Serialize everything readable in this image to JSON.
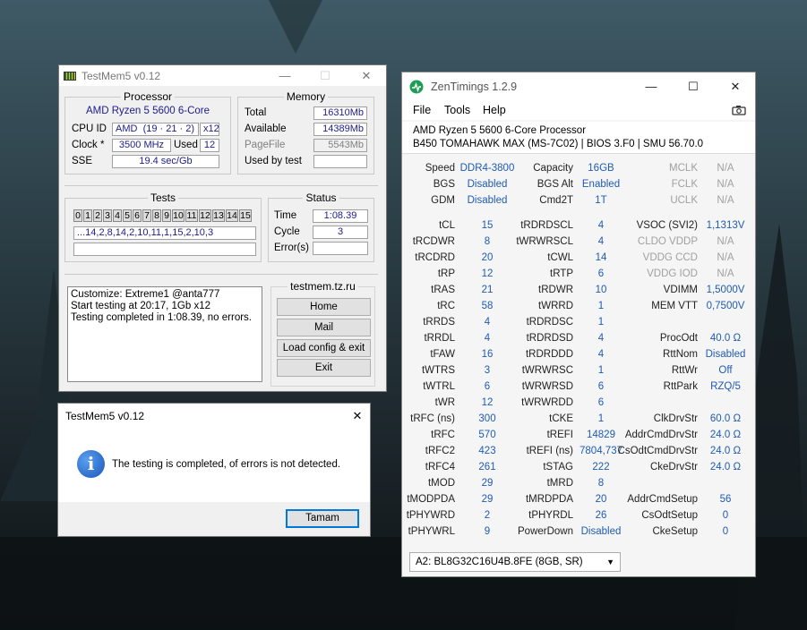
{
  "testmem": {
    "title": "TestMem5 v0.12",
    "controls": {
      "minimize": "—",
      "maximize": "☐",
      "close": "✕"
    },
    "processor": {
      "group_title": "Processor",
      "name": "AMD Ryzen 5 5600 6-Core",
      "cpu_id_label": "CPU ID",
      "cpu_id_vendor": "AMD",
      "cpu_id_value": "(19 · 21 · 2)",
      "cpu_id_threads": "x12",
      "clock_label": "Clock *",
      "clock_value": "3500 MHz",
      "used_label": "Used",
      "used_value": "12",
      "sse_label": "SSE",
      "sse_value": "19.4 sec/Gb"
    },
    "memory": {
      "group_title": "Memory",
      "total_label": "Total",
      "total_value": "16310Mb",
      "available_label": "Available",
      "available_value": "14389Mb",
      "pagefile_label": "PageFile",
      "pagefile_value": "5543Mb",
      "usedbytest_label": "Used by test",
      "usedbytest_value": ""
    },
    "tests": {
      "group_title": "Tests",
      "cells": [
        "0",
        "1",
        "2",
        "3",
        "4",
        "5",
        "6",
        "7",
        "8",
        "9",
        "10",
        "11",
        "12",
        "13",
        "14",
        "15"
      ],
      "sequence": "...14,2,8,14,2,10,11,1,15,2,10,3"
    },
    "status": {
      "group_title": "Status",
      "time_label": "Time",
      "time_value": "1:08.39",
      "cycle_label": "Cycle",
      "cycle_value": "3",
      "errors_label": "Error(s)",
      "errors_value": ""
    },
    "log": {
      "line1": "Customize: Extreme1 @anta777",
      "line2": "Start testing at 20:17, 1Gb x12",
      "line3": "Testing completed in 1:08.39, no errors."
    },
    "site": "testmem.tz.ru",
    "buttons": {
      "home": "Home",
      "mail": "Mail",
      "load": "Load config & exit",
      "exit": "Exit"
    }
  },
  "dialog": {
    "title": "TestMem5 v0.12",
    "close": "✕",
    "icon": "i",
    "message": "The testing is completed, of errors is not detected.",
    "ok": "Tamam"
  },
  "zen": {
    "title": "ZenTimings 1.2.9",
    "controls": {
      "minimize": "—",
      "maximize": "☐",
      "close": "✕"
    },
    "menu": {
      "file": "File",
      "tools": "Tools",
      "help": "Help"
    },
    "cpu": "AMD Ryzen 5 5600 6-Core Processor",
    "board": "B450 TOMAHAWK MAX (MS-7C02) | BIOS 3.F0 | SMU 56.70.0",
    "top": [
      [
        "Speed",
        "DDR4-3800",
        "Capacity",
        "16GB",
        "MCLK",
        "N/A"
      ],
      [
        "BGS",
        "Disabled",
        "BGS Alt",
        "Enabled",
        "FCLK",
        "N/A"
      ],
      [
        "GDM",
        "Disabled",
        "Cmd2T",
        "1T",
        "UCLK",
        "N/A"
      ]
    ],
    "timings": [
      [
        "tCL",
        "15",
        "tRDRDSCL",
        "4",
        "VSOC (SVI2)",
        "1,1313V"
      ],
      [
        "tRCDWR",
        "8",
        "tWRWRSCL",
        "4",
        "CLDO VDDP",
        "N/A"
      ],
      [
        "tRCDRD",
        "20",
        "tCWL",
        "14",
        "VDDG CCD",
        "N/A"
      ],
      [
        "tRP",
        "12",
        "tRTP",
        "6",
        "VDDG IOD",
        "N/A"
      ],
      [
        "tRAS",
        "21",
        "tRDWR",
        "10",
        "VDIMM",
        "1,5000V"
      ],
      [
        "tRC",
        "58",
        "tWRRD",
        "1",
        "MEM VTT",
        "0,7500V"
      ],
      [
        "tRRDS",
        "4",
        "tRDRDSC",
        "1",
        "",
        ""
      ],
      [
        "tRRDL",
        "4",
        "tRDRDSD",
        "4",
        "ProcOdt",
        "40.0 Ω"
      ],
      [
        "tFAW",
        "16",
        "tRDRDDD",
        "4",
        "RttNom",
        "Disabled"
      ],
      [
        "tWTRS",
        "3",
        "tWRWRSC",
        "1",
        "RttWr",
        "Off"
      ],
      [
        "tWTRL",
        "6",
        "tWRWRSD",
        "6",
        "RttPark",
        "RZQ/5"
      ],
      [
        "tWR",
        "12",
        "tWRWRDD",
        "6",
        "",
        ""
      ],
      [
        "tRFC (ns)",
        "300",
        "tCKE",
        "1",
        "ClkDrvStr",
        "60.0 Ω"
      ],
      [
        "tRFC",
        "570",
        "tREFI",
        "14829",
        "AddrCmdDrvStr",
        "24.0 Ω"
      ],
      [
        "tRFC2",
        "423",
        "tREFI (ns)",
        "7804,737",
        "CsOdtCmdDrvStr",
        "24.0 Ω"
      ],
      [
        "tRFC4",
        "261",
        "tSTAG",
        "222",
        "CkeDrvStr",
        "24.0 Ω"
      ],
      [
        "tMOD",
        "29",
        "tMRD",
        "8",
        "",
        ""
      ],
      [
        "tMODPDA",
        "29",
        "tMRDPDA",
        "20",
        "AddrCmdSetup",
        "56"
      ],
      [
        "tPHYWRD",
        "2",
        "tPHYRDL",
        "26",
        "CsOdtSetup",
        "0"
      ],
      [
        "tPHYWRL",
        "9",
        "PowerDown",
        "Disabled",
        "CkeSetup",
        "0"
      ]
    ],
    "dim_keys": [
      "MCLK",
      "FCLK",
      "UCLK",
      "CLDO VDDP",
      "VDDG CCD",
      "VDDG IOD"
    ],
    "module": "A2: BL8G32C16U4B.8FE (8GB, SR)"
  }
}
